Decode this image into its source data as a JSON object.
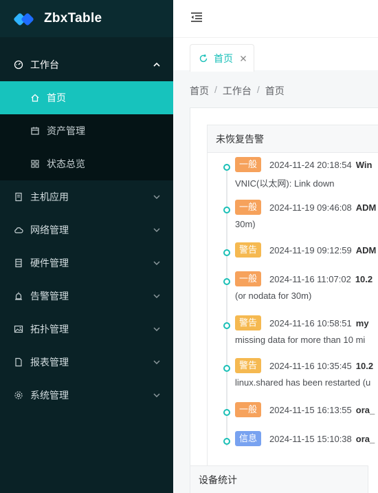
{
  "brand": {
    "title": "ZbxTable"
  },
  "sidebar": {
    "groups": [
      {
        "label": "工作台",
        "icon": "dashboard-icon",
        "open": true,
        "children": [
          {
            "label": "首页",
            "icon": "home-icon",
            "active": true
          },
          {
            "label": "资产管理",
            "icon": "calendar-icon"
          },
          {
            "label": "状态总览",
            "icon": "grid-icon"
          }
        ]
      },
      {
        "label": "主机应用",
        "icon": "server-icon"
      },
      {
        "label": "网络管理",
        "icon": "cloud-icon"
      },
      {
        "label": "硬件管理",
        "icon": "hardware-icon"
      },
      {
        "label": "告警管理",
        "icon": "alarm-icon"
      },
      {
        "label": "拓扑管理",
        "icon": "image-icon"
      },
      {
        "label": "报表管理",
        "icon": "file-icon"
      },
      {
        "label": "系统管理",
        "icon": "settings-icon"
      }
    ]
  },
  "tabs": [
    {
      "label": "首页"
    }
  ],
  "breadcrumb": [
    "首页",
    "工作台",
    "首页"
  ],
  "alerts_card": {
    "title": "未恢复告警",
    "items": [
      {
        "level": "一般",
        "color": "#f6a25c",
        "time": "2024-11-24 20:18:54",
        "host": "Win",
        "message": "VNIC(以太网): Link down"
      },
      {
        "level": "一般",
        "color": "#f6a25c",
        "time": "2024-11-19 09:46:08",
        "host": "ADM",
        "message": "30m)"
      },
      {
        "level": "警告",
        "color": "#f5b951",
        "time": "2024-11-19 09:12:59",
        "host": "ADM",
        "message": ""
      },
      {
        "level": "一般",
        "color": "#f6a25c",
        "time": "2024-11-16 11:07:02",
        "host": "10.2",
        "message": "(or nodata for 30m)"
      },
      {
        "level": "警告",
        "color": "#f5b951",
        "time": "2024-11-16 10:58:51",
        "host": "my",
        "message": "missing data for more than 10 mi"
      },
      {
        "level": "警告",
        "color": "#f5b951",
        "time": "2024-11-16 10:35:45",
        "host": "10.2",
        "message": "linux.shared has been restarted (u"
      },
      {
        "level": "一般",
        "color": "#f6a25c",
        "time": "2024-11-15 16:13:55",
        "host": "ora_",
        "message": ""
      },
      {
        "level": "信息",
        "color": "#78a2f0",
        "time": "2024-11-15 15:10:38",
        "host": "ora_",
        "message": ""
      }
    ]
  },
  "device_card": {
    "title": "设备统计"
  }
}
